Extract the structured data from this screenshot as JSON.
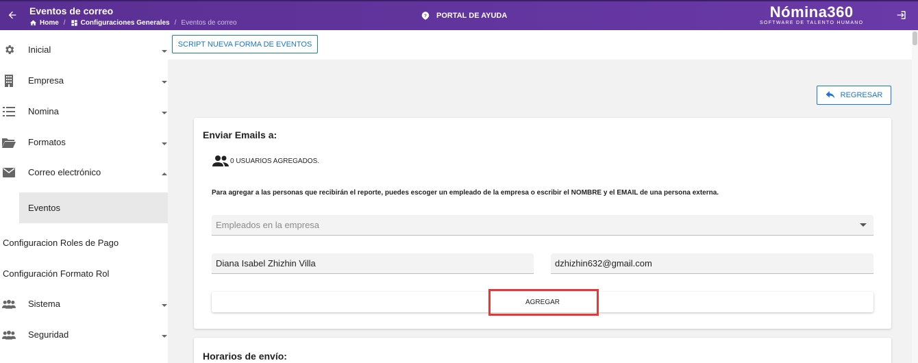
{
  "header": {
    "title": "Eventos de correo",
    "breadcrumb": [
      {
        "label": "Home",
        "icon": "home-icon"
      },
      {
        "label": "Configuraciones Generales",
        "icon": "dashboard-icon"
      },
      {
        "label": "Eventos de correo"
      }
    ],
    "help_label": "PORTAL DE AYUDA",
    "logo_brand": "Nómina360",
    "logo_tagline": "SOFTWARE DE TALENTO HUMANO",
    "colors": {
      "bar": "#5a2f93",
      "accent": "#1976d2",
      "highlight": "#e53935"
    }
  },
  "sidebar": {
    "items": [
      {
        "label": "Inicial",
        "icon": "gear-icon"
      },
      {
        "label": "Empresa",
        "icon": "building-icon"
      },
      {
        "label": "Nomina",
        "icon": "list-icon"
      },
      {
        "label": "Formatos",
        "icon": "folder-open-icon"
      },
      {
        "label": "Correo electrónico",
        "icon": "mail-icon"
      },
      {
        "label": "Eventos"
      },
      {
        "label": "Configuracion Roles de Pago"
      },
      {
        "label": "Configuración Formato Rol"
      },
      {
        "label": "Sistema",
        "icon": "group-icon"
      },
      {
        "label": "Seguridad",
        "icon": "group-icon"
      }
    ]
  },
  "toolbar": {
    "script_label": "SCRIPT NUEVA FORMA DE EVENTOS",
    "back_label": "REGRESAR"
  },
  "emails": {
    "title": "Enviar Emails a:",
    "users_added": "0 USUARIOS AGREGADOS.",
    "instructions": "Para agregar a las personas que recibirán el reporte, puedes escoger un empleado de la empresa o escribir el NOMBRE y el EMAIL de una persona externa.",
    "employee_select_placeholder": "Empleados en la empresa",
    "name_value": "Diana Isabel Zhizhin Villa",
    "email_value": "dzhizhin632@gmail.com",
    "add_label": "AGREGAR"
  },
  "schedule": {
    "title": "Horarios de envío:"
  }
}
